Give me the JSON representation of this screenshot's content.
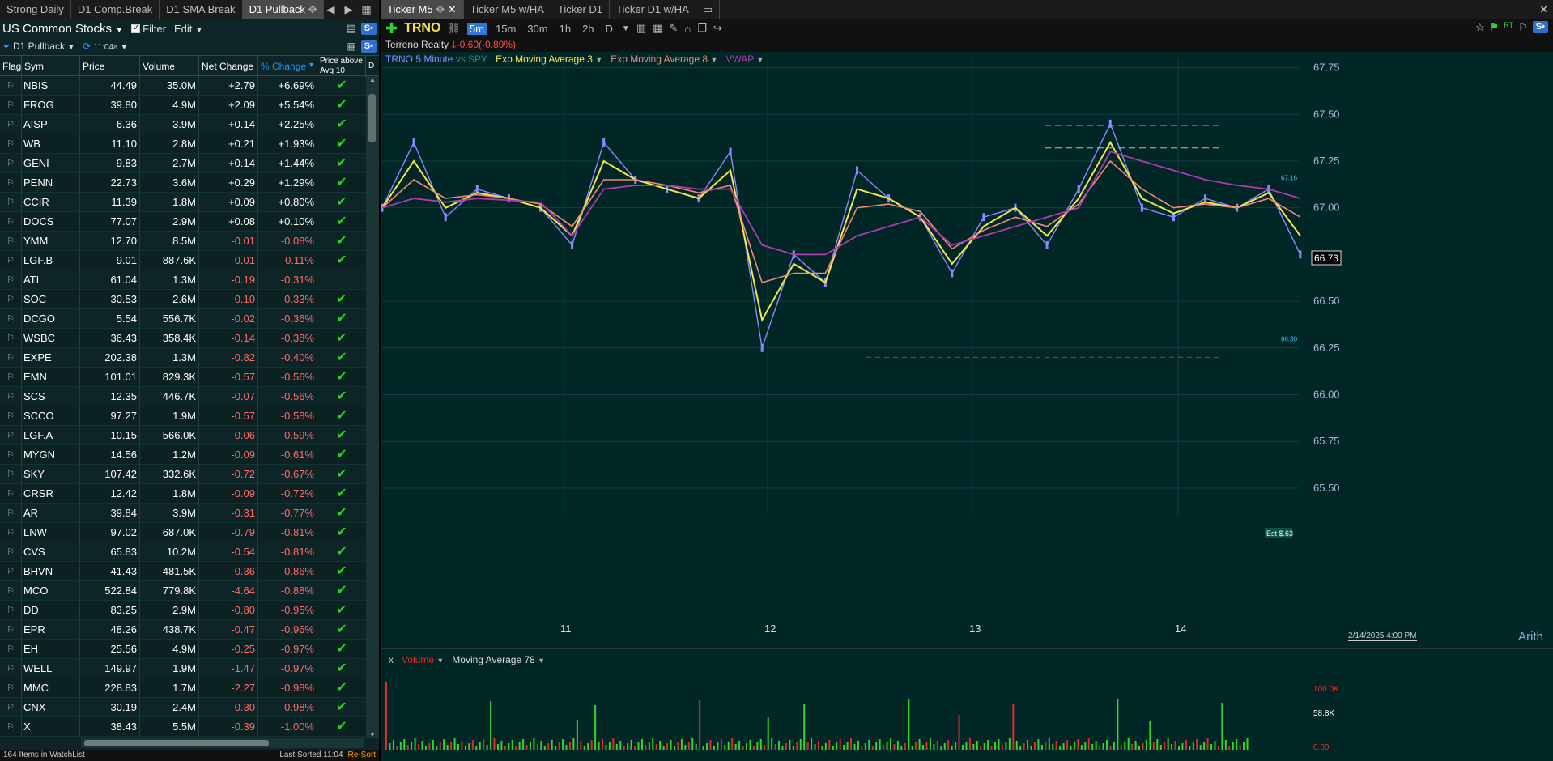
{
  "left": {
    "tabs": [
      "Strong Daily",
      "D1 Comp.Break",
      "D1 SMA Break",
      "D1 Pullback"
    ],
    "active_tab": 3,
    "watchlist_title": "US Common Stocks",
    "filter_label": "Filter",
    "edit_label": "Edit",
    "s_btn": "S•",
    "scan_name": "D1 Pullback",
    "refresh_time": "11:04a",
    "columns": {
      "flag": "Flag",
      "sym": "Sym",
      "price": "Price",
      "volume": "Volume",
      "net": "Net Change",
      "pct": "% Change",
      "pa1": "Price above",
      "pa2": "Avg 10",
      "d": "D"
    },
    "rows": [
      {
        "sym": "NBIS",
        "price": "44.49",
        "vol": "35.0M",
        "net": "+2.79",
        "pct": "+6.69%",
        "pa": true
      },
      {
        "sym": "FROG",
        "price": "39.80",
        "vol": "4.9M",
        "net": "+2.09",
        "pct": "+5.54%",
        "pa": true
      },
      {
        "sym": "AISP",
        "price": "6.36",
        "vol": "3.9M",
        "net": "+0.14",
        "pct": "+2.25%",
        "pa": true
      },
      {
        "sym": "WB",
        "price": "11.10",
        "vol": "2.8M",
        "net": "+0.21",
        "pct": "+1.93%",
        "pa": true
      },
      {
        "sym": "GENI",
        "price": "9.83",
        "vol": "2.7M",
        "net": "+0.14",
        "pct": "+1.44%",
        "pa": true
      },
      {
        "sym": "PENN",
        "price": "22.73",
        "vol": "3.6M",
        "net": "+0.29",
        "pct": "+1.29%",
        "pa": true
      },
      {
        "sym": "CCIR",
        "price": "11.39",
        "vol": "1.8M",
        "net": "+0.09",
        "pct": "+0.80%",
        "pa": true
      },
      {
        "sym": "DOCS",
        "price": "77.07",
        "vol": "2.9M",
        "net": "+0.08",
        "pct": "+0.10%",
        "pa": true
      },
      {
        "sym": "YMM",
        "price": "12.70",
        "vol": "8.5M",
        "net": "-0.01",
        "pct": "-0.08%",
        "pa": true
      },
      {
        "sym": "LGF.B",
        "price": "9.01",
        "vol": "887.6K",
        "net": "-0.01",
        "pct": "-0.11%",
        "pa": true
      },
      {
        "sym": "ATI",
        "price": "61.04",
        "vol": "1.3M",
        "net": "-0.19",
        "pct": "-0.31%",
        "pa": false
      },
      {
        "sym": "SOC",
        "price": "30.53",
        "vol": "2.6M",
        "net": "-0.10",
        "pct": "-0.33%",
        "pa": true
      },
      {
        "sym": "DCGO",
        "price": "5.54",
        "vol": "556.7K",
        "net": "-0.02",
        "pct": "-0.36%",
        "pa": true
      },
      {
        "sym": "WSBC",
        "price": "36.43",
        "vol": "358.4K",
        "net": "-0.14",
        "pct": "-0.38%",
        "pa": true
      },
      {
        "sym": "EXPE",
        "price": "202.38",
        "vol": "1.3M",
        "net": "-0.82",
        "pct": "-0.40%",
        "pa": true
      },
      {
        "sym": "EMN",
        "price": "101.01",
        "vol": "829.3K",
        "net": "-0.57",
        "pct": "-0.56%",
        "pa": true
      },
      {
        "sym": "SCS",
        "price": "12.35",
        "vol": "446.7K",
        "net": "-0.07",
        "pct": "-0.56%",
        "pa": true
      },
      {
        "sym": "SCCO",
        "price": "97.27",
        "vol": "1.9M",
        "net": "-0.57",
        "pct": "-0.58%",
        "pa": true
      },
      {
        "sym": "LGF.A",
        "price": "10.15",
        "vol": "566.0K",
        "net": "-0.06",
        "pct": "-0.59%",
        "pa": true
      },
      {
        "sym": "MYGN",
        "price": "14.56",
        "vol": "1.2M",
        "net": "-0.09",
        "pct": "-0.61%",
        "pa": true
      },
      {
        "sym": "SKY",
        "price": "107.42",
        "vol": "332.6K",
        "net": "-0.72",
        "pct": "-0.67%",
        "pa": true
      },
      {
        "sym": "CRSR",
        "price": "12.42",
        "vol": "1.8M",
        "net": "-0.09",
        "pct": "-0.72%",
        "pa": true
      },
      {
        "sym": "AR",
        "price": "39.84",
        "vol": "3.9M",
        "net": "-0.31",
        "pct": "-0.77%",
        "pa": true
      },
      {
        "sym": "LNW",
        "price": "97.02",
        "vol": "687.0K",
        "net": "-0.79",
        "pct": "-0.81%",
        "pa": true
      },
      {
        "sym": "CVS",
        "price": "65.83",
        "vol": "10.2M",
        "net": "-0.54",
        "pct": "-0.81%",
        "pa": true
      },
      {
        "sym": "BHVN",
        "price": "41.43",
        "vol": "481.5K",
        "net": "-0.36",
        "pct": "-0.86%",
        "pa": true
      },
      {
        "sym": "MCO",
        "price": "522.84",
        "vol": "779.8K",
        "net": "-4.64",
        "pct": "-0.88%",
        "pa": true
      },
      {
        "sym": "DD",
        "price": "83.25",
        "vol": "2.9M",
        "net": "-0.80",
        "pct": "-0.95%",
        "pa": true
      },
      {
        "sym": "EPR",
        "price": "48.26",
        "vol": "438.7K",
        "net": "-0.47",
        "pct": "-0.96%",
        "pa": true
      },
      {
        "sym": "EH",
        "price": "25.56",
        "vol": "4.9M",
        "net": "-0.25",
        "pct": "-0.97%",
        "pa": true
      },
      {
        "sym": "WELL",
        "price": "149.97",
        "vol": "1.9M",
        "net": "-1.47",
        "pct": "-0.97%",
        "pa": true
      },
      {
        "sym": "MMC",
        "price": "228.83",
        "vol": "1.7M",
        "net": "-2.27",
        "pct": "-0.98%",
        "pa": true
      },
      {
        "sym": "CNX",
        "price": "30.19",
        "vol": "2.4M",
        "net": "-0.30",
        "pct": "-0.98%",
        "pa": true
      },
      {
        "sym": "X",
        "price": "38.43",
        "vol": "5.5M",
        "net": "-0.39",
        "pct": "-1.00%",
        "pa": true
      }
    ],
    "status_items": "164 Items in WatchList",
    "status_sorted": "Last Sorted 11:04",
    "status_resort": "Re-Sort"
  },
  "right": {
    "tabs": [
      "Ticker M5",
      "Ticker M5 w/HA",
      "Ticker D1",
      "Ticker D1 w/HA"
    ],
    "active_tab": 0,
    "symbol": "TRNO",
    "timeframes": [
      "5m",
      "15m",
      "30m",
      "1h",
      "2h",
      "D"
    ],
    "active_tf": 0,
    "company": "Terreno Realty",
    "change": "-0.60(-0.89%)",
    "legend": {
      "main": "TRNO 5 Minute",
      "vs": "vs SPY",
      "ema3": "Exp Moving Average 3",
      "ema8": "Exp Moving Average 8",
      "vwap": "VWAP"
    },
    "colors": {
      "ema3": "#f5e84a",
      "ema8": "#f08a7a",
      "vwap": "#b03ab0",
      "price": "#8a8aff",
      "spy": "#2a8a8a",
      "up": "#2ed82e",
      "down": "#e02a2a"
    },
    "last_price": "66.73",
    "est_label": "Est $.63",
    "price_marker_1": "67.16",
    "price_marker_2": "66.30",
    "date_label": "2/14/2025 4:00 PM",
    "arith": "Arith",
    "vol_close": "x",
    "vol_label": "Volume",
    "vol_ma": "Moving Average 78",
    "vol_ticks": [
      "100.0K",
      "58.8K",
      "0.00"
    ],
    "chart_data": {
      "type": "line",
      "title": "TRNO 5 Minute",
      "x_ticks": [
        "11",
        "12",
        "13",
        "14"
      ],
      "y_ticks": [
        "67.75",
        "67.50",
        "67.25",
        "67.00",
        "66.50",
        "66.25",
        "66.00",
        "65.75",
        "65.50"
      ],
      "ylim": [
        65.4,
        67.8
      ],
      "series": [
        {
          "name": "TRNO 5 Minute",
          "values": [
            67.0,
            67.35,
            66.95,
            67.1,
            67.05,
            67.0,
            66.8,
            67.35,
            67.15,
            67.1,
            67.05,
            67.3,
            66.25,
            66.75,
            66.6,
            67.2,
            67.05,
            66.95,
            66.65,
            66.95,
            67.0,
            66.8,
            67.1,
            67.45,
            67.0,
            66.95,
            67.05,
            67.0,
            67.1,
            66.75
          ]
        },
        {
          "name": "Exp Moving Average 3",
          "values": [
            67.0,
            67.25,
            67.0,
            67.08,
            67.05,
            67.0,
            66.85,
            67.25,
            67.15,
            67.1,
            67.05,
            67.2,
            66.4,
            66.7,
            66.6,
            67.1,
            67.05,
            66.95,
            66.7,
            66.9,
            67.0,
            66.85,
            67.05,
            67.35,
            67.05,
            66.97,
            67.03,
            67.0,
            67.08,
            66.85
          ]
        },
        {
          "name": "Exp Moving Average 8",
          "values": [
            67.0,
            67.15,
            67.05,
            67.07,
            67.05,
            67.02,
            66.9,
            67.15,
            67.15,
            67.12,
            67.08,
            67.12,
            66.6,
            66.65,
            66.65,
            67.0,
            67.02,
            66.98,
            66.78,
            66.88,
            66.95,
            66.9,
            67.02,
            67.25,
            67.1,
            67.0,
            67.02,
            67.0,
            67.05,
            66.95
          ]
        },
        {
          "name": "VWAP",
          "values": [
            67.0,
            67.05,
            67.03,
            67.05,
            67.04,
            67.03,
            66.85,
            67.1,
            67.12,
            67.12,
            67.1,
            67.1,
            66.8,
            66.75,
            66.75,
            66.85,
            66.9,
            66.95,
            66.8,
            66.85,
            66.9,
            66.95,
            67.0,
            67.3,
            67.25,
            67.2,
            67.15,
            67.12,
            67.1,
            67.05
          ]
        }
      ],
      "grid": true
    }
  }
}
